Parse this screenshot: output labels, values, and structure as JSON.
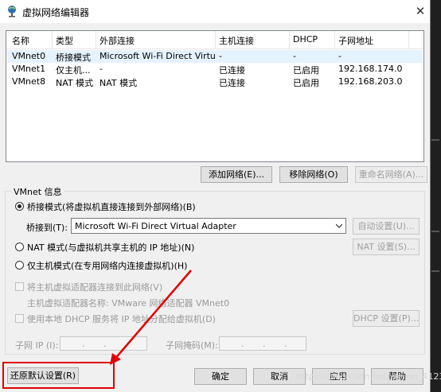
{
  "window": {
    "title": "虚拟网络编辑器"
  },
  "list": {
    "columns": [
      "名称",
      "类型",
      "外部连接",
      "主机连接",
      "DHCP",
      "子网地址"
    ],
    "rows": [
      [
        "VMnet0",
        "桥接模式",
        "Microsoft Wi-Fi Direct Virtual...",
        "-",
        "-",
        "-"
      ],
      [
        "VMnet1",
        "仅主机...",
        "-",
        "已连接",
        "已启用",
        "192.168.174.0"
      ],
      [
        "VMnet8",
        "NAT 模式",
        "NAT 模式",
        "已连接",
        "已启用",
        "192.168.203.0"
      ]
    ]
  },
  "list_buttons": {
    "add": "添加网络(E)...",
    "remove": "移除网络(O)",
    "rename": "重命名网络(A)..."
  },
  "vmnet_info": {
    "title": "VMnet 信息",
    "bridged": "桥接模式(将虚拟机直接连接到外部网络)(B)",
    "bridged_to_label": "桥接到(T):",
    "bridged_to_value": "Microsoft Wi-Fi Direct Virtual Adapter",
    "auto_settings": "自动设置(U)...",
    "nat": "NAT 模式(与虚拟机共享主机的 IP 地址)(N)",
    "nat_settings": "NAT 设置(S)...",
    "host_only": "仅主机模式(在专用网络内连接虚拟机)(H)",
    "connect_adapter": "将主机虚拟适配器连接到此网络(V)",
    "adapter_name": "主机虚拟适配器名称: VMware 网络适配器 VMnet0",
    "use_dhcp": "使用本地 DHCP 服务将 IP 地址分配给虚拟机(D)",
    "dhcp_settings": "DHCP 设置(P)...",
    "subnet_ip": "子网 IP (I):",
    "subnet_mask": "子网掩码(M):"
  },
  "bottom": {
    "restore_defaults": "还原默认设置(R)",
    "ok": "确定",
    "cancel": "取消",
    "apply": "应用",
    "help": "帮助"
  },
  "watermark": "https://blog.csdn.net/weixin_4123",
  "colors": {
    "highlight_box": "#e00000",
    "selected_row": "#e5f3ff"
  }
}
